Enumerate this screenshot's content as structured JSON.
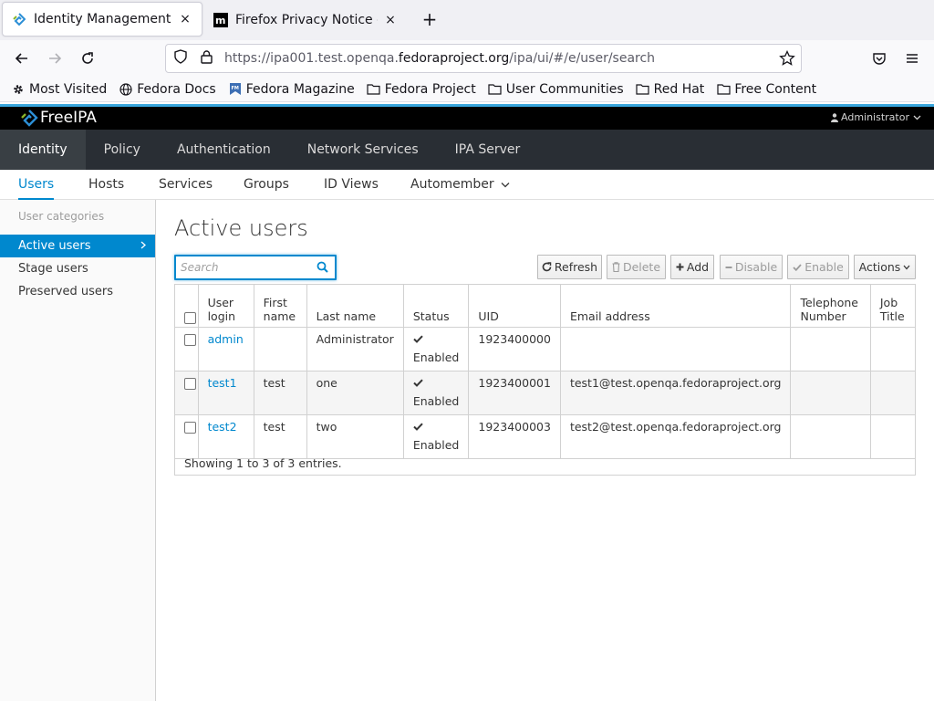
{
  "browser": {
    "tabs": [
      {
        "title": "Identity Management",
        "close": "×"
      },
      {
        "title": "Firefox Privacy Notice — M",
        "close": "×"
      }
    ],
    "new_tab": "+",
    "url": {
      "prefix": "https://ipa001.test.openqa.",
      "domain": "fedoraproject.org",
      "path": "/ipa/ui/#/e/user/search"
    },
    "bookmarks": [
      "Most Visited",
      "Fedora Docs",
      "Fedora Magazine",
      "Fedora Project",
      "User Communities",
      "Red Hat",
      "Free Content"
    ]
  },
  "app": {
    "brand": "FreeIPA",
    "user_menu": "Administrator",
    "main_nav": [
      "Identity",
      "Policy",
      "Authentication",
      "Network Services",
      "IPA Server"
    ],
    "sub_nav": [
      "Users",
      "Hosts",
      "Services",
      "Groups",
      "ID Views",
      "Automember"
    ],
    "sidebar": {
      "category": "User categories",
      "items": [
        "Active users",
        "Stage users",
        "Preserved users"
      ]
    },
    "page_title": "Active users",
    "search_placeholder": "Search",
    "buttons": {
      "refresh": "Refresh",
      "delete": "Delete",
      "add": "Add",
      "disable": "Disable",
      "enable": "Enable",
      "actions": "Actions"
    },
    "table": {
      "headers": [
        "User login",
        "First name",
        "Last name",
        "Status",
        "UID",
        "Email address",
        "Telephone Number",
        "Job Title"
      ],
      "rows": [
        {
          "login": "admin",
          "first": "",
          "last": "Administrator",
          "status": "Enabled",
          "uid": "1923400000",
          "email": ""
        },
        {
          "login": "test1",
          "first": "test",
          "last": "one",
          "status": "Enabled",
          "uid": "1923400001",
          "email": "test1@test.openqa.fedoraproject.org"
        },
        {
          "login": "test2",
          "first": "test",
          "last": "two",
          "status": "Enabled",
          "uid": "1923400003",
          "email": "test2@test.openqa.fedoraproject.org"
        }
      ],
      "footer": "Showing 1 to 3 of 3 entries."
    }
  }
}
